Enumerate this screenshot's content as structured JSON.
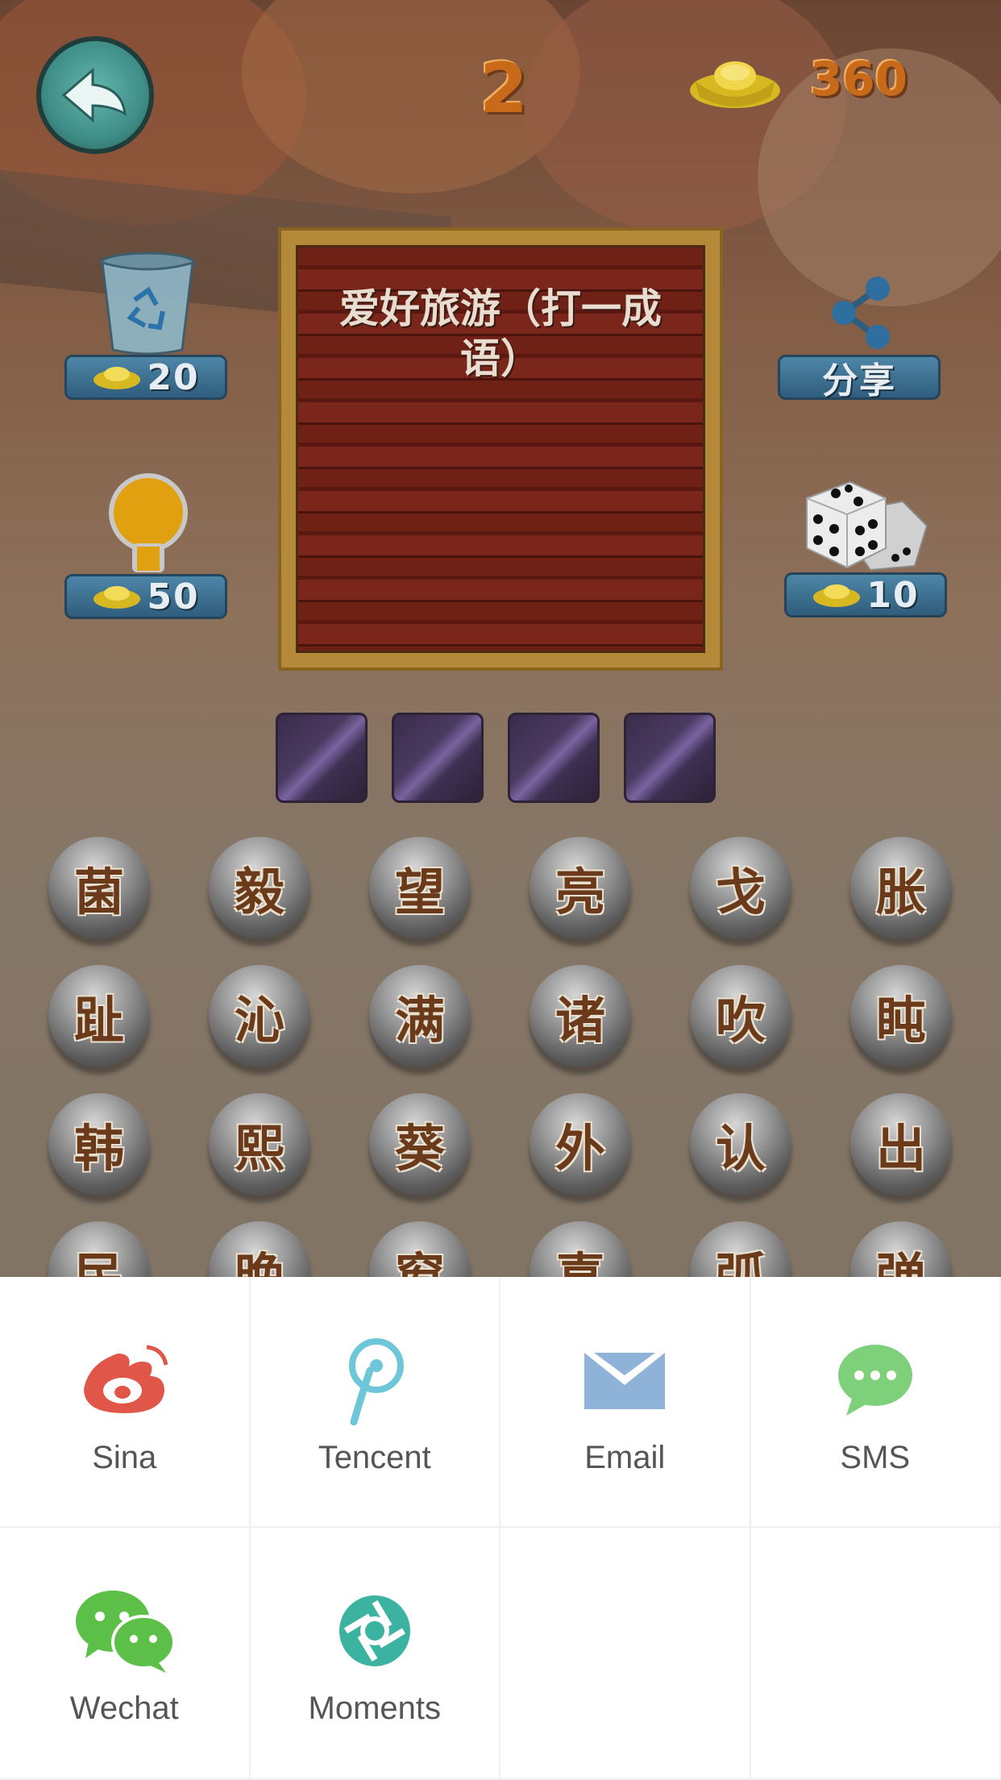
{
  "header": {
    "level": "2",
    "coins": "360"
  },
  "tools": {
    "remove": {
      "price": "20"
    },
    "hint": {
      "price": "50"
    },
    "share": {
      "label": "分享"
    },
    "random": {
      "price": "10"
    }
  },
  "question": {
    "text": "爱好旅游（打一成语）"
  },
  "answer_slots": 4,
  "characters": [
    "菌",
    "毅",
    "望",
    "亮",
    "戈",
    "胀",
    "趾",
    "沁",
    "满",
    "诸",
    "吹",
    "盹",
    "韩",
    "熙",
    "葵",
    "外",
    "认",
    "出",
    "民",
    "晚",
    "窗",
    "喜",
    "弧",
    "弹"
  ],
  "share_sheet": {
    "items": [
      {
        "label": "Sina",
        "icon": "sina-weibo-icon",
        "color": "#e0574a"
      },
      {
        "label": "Tencent",
        "icon": "tencent-weibo-icon",
        "color": "#6ec7d8"
      },
      {
        "label": "Email",
        "icon": "email-icon",
        "color": "#8fb2d9"
      },
      {
        "label": "SMS",
        "icon": "sms-icon",
        "color": "#7ed07a"
      },
      {
        "label": "Wechat",
        "icon": "wechat-icon",
        "color": "#5cbf47"
      },
      {
        "label": "Moments",
        "icon": "moments-icon",
        "color": "#3bb3a0"
      }
    ]
  }
}
